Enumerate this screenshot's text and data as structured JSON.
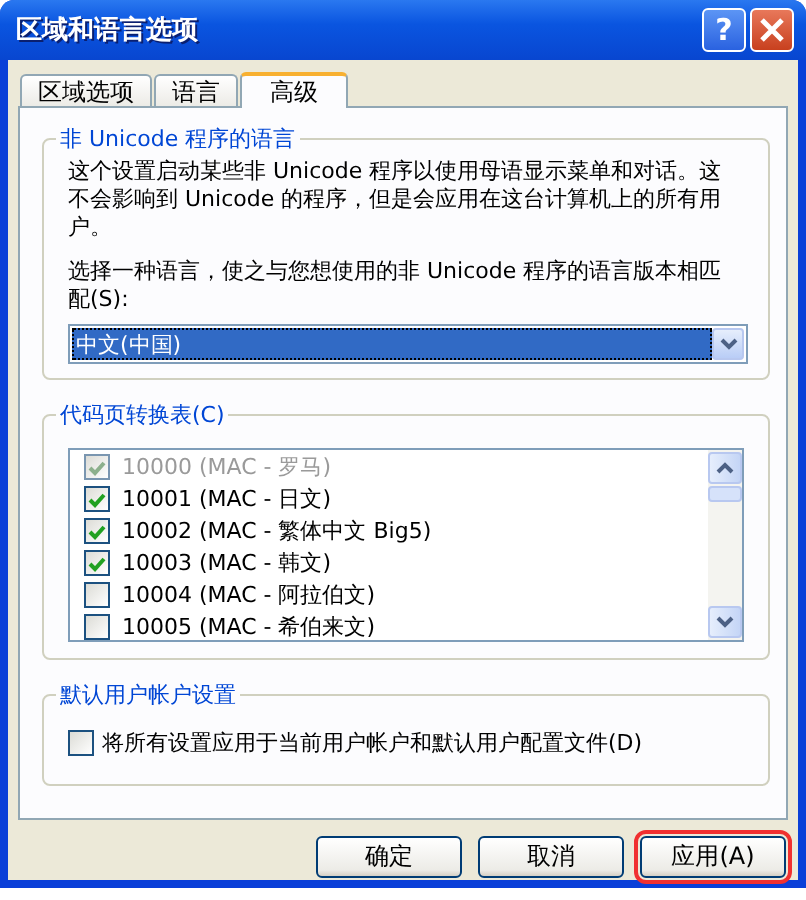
{
  "window": {
    "title": "区域和语言选项",
    "help_button": "?"
  },
  "tabs": [
    {
      "label": "区域选项",
      "selected": false
    },
    {
      "label": "语言",
      "selected": false
    },
    {
      "label": "高级",
      "selected": true
    }
  ],
  "non_unicode_group": {
    "title": "非 Unicode 程序的语言",
    "description": "这个设置启动某些非 Unicode 程序以使用母语显示菜单和对话。这不会影响到 Unicode 的程序，但是会应用在这台计算机上的所有用户。",
    "prompt": "选择一种语言，使之与您想使用的非 Unicode 程序的语言版本相匹配(S):",
    "language_dropdown": {
      "value": "中文(中国)"
    }
  },
  "code_page_group": {
    "title": "代码页转换表(C)",
    "items": [
      {
        "label": "10000 (MAC - 罗马)",
        "checked": true,
        "disabled": true
      },
      {
        "label": "10001 (MAC - 日文)",
        "checked": true,
        "disabled": false
      },
      {
        "label": "10002 (MAC - 繁体中文 Big5)",
        "checked": true,
        "disabled": false
      },
      {
        "label": "10003 (MAC - 韩文)",
        "checked": true,
        "disabled": false
      },
      {
        "label": "10004 (MAC - 阿拉伯文)",
        "checked": false,
        "disabled": false
      },
      {
        "label": "10005 (MAC - 希伯来文)",
        "checked": false,
        "disabled": false
      }
    ]
  },
  "default_user_group": {
    "title": "默认用户帐户设置",
    "checkbox": {
      "label": "将所有设置应用于当前用户帐户和默认用户配置文件(D)",
      "checked": false
    }
  },
  "buttons": [
    {
      "label": "确定",
      "highlighted": false
    },
    {
      "label": "取消",
      "highlighted": false
    },
    {
      "label": "应用(A)",
      "highlighted": true
    }
  ]
}
